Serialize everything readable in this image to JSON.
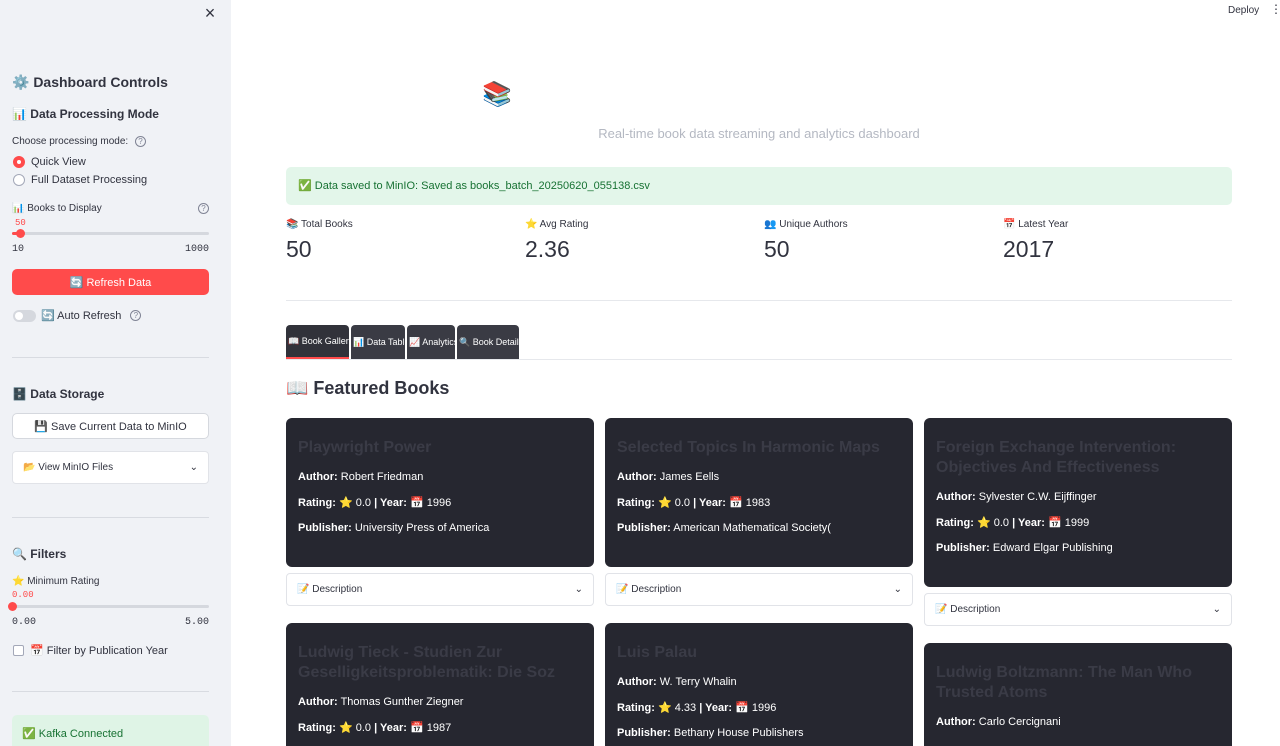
{
  "sidebar": {
    "close_icon": "×",
    "dashboard_controls": "⚙️ Dashboard Controls",
    "processing_heading": "📊 Data Processing Mode",
    "processing_label": "Choose processing mode:",
    "mode_quick": "Quick View",
    "mode_full": "Full Dataset Processing",
    "books_label": "📊 Books to Display",
    "books_value": "50",
    "books_min": "10",
    "books_max": "1000",
    "books_fraction": 0.04,
    "refresh_button": "🔄 Refresh Data",
    "auto_refresh": "🔄 Auto Refresh",
    "storage_heading": "🗄️ Data Storage",
    "save_button": "💾 Save Current Data to MinIO",
    "view_files": "📂 View MinIO Files",
    "filters_heading": "🔍 Filters",
    "rating_label": "⭐ Minimum Rating",
    "rating_value": "0.00",
    "rating_min": "0.00",
    "rating_max": "5.00",
    "rating_fraction": 0.0,
    "filter_year": "📅 Filter by Publication Year",
    "kafka_status": "✅ Kafka Connected"
  },
  "header": {
    "deploy": "Deploy",
    "menu": "⋮"
  },
  "main": {
    "hero_icon": "📚",
    "subtitle": "Real-time book data streaming and analytics dashboard",
    "alert": "✅ Data saved to MinIO: Saved as books_batch_20250620_055138.csv",
    "metrics": [
      {
        "label": "📚 Total Books",
        "value": "50"
      },
      {
        "label": "⭐ Avg Rating",
        "value": "2.36"
      },
      {
        "label": "👥 Unique Authors",
        "value": "50"
      },
      {
        "label": "📅 Latest Year",
        "value": "2017"
      }
    ],
    "tabs": [
      "📖 Book Gallery",
      "📊 Data Table",
      "📈 Analytics",
      "🔍 Book Details"
    ],
    "section_title": "📖 Featured Books",
    "labels": {
      "author": "Author:",
      "rating": "Rating:",
      "year": "| Year:",
      "publisher": "Publisher:",
      "description": "📝 Description"
    },
    "books": [
      {
        "title": "Playwright Power",
        "author": "Robert Friedman",
        "rating": "⭐ 0.0",
        "year": "📅 1996",
        "publisher": "University Press of America"
      },
      {
        "title": "Selected Topics In Harmonic Maps",
        "author": "James Eells",
        "rating": "⭐ 0.0",
        "year": "📅 1983",
        "publisher": "American Mathematical Society("
      },
      {
        "title": "Foreign Exchange Intervention: Objectives And Effectiveness",
        "author": "Sylvester C.W. Eijffinger",
        "rating": "⭐ 0.0",
        "year": "📅 1999",
        "publisher": "Edward Elgar Publishing"
      },
      {
        "title": "Ludwig Tieck - Studien Zur Geselligkeitsproblematik: Die Soz",
        "author": "Thomas Gunther Ziegner",
        "rating": "⭐ 0.0",
        "year": "📅 1987",
        "publisher": ""
      },
      {
        "title": "Luis Palau",
        "author": "W. Terry Whalin",
        "rating": "⭐ 4.33",
        "year": "📅 1996",
        "publisher": "Bethany House Publishers"
      },
      {
        "title": "Ludwig Boltzmann: The Man Who Trusted Atoms",
        "author": "Carlo Cercignani",
        "rating": "",
        "year": "",
        "publisher": ""
      }
    ]
  }
}
